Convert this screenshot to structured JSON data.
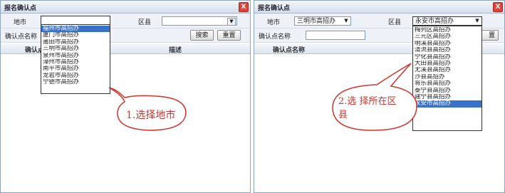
{
  "left": {
    "title": "报名确认点",
    "close": "X",
    "city_label": "地市",
    "city_value": "",
    "district_label": "区县",
    "district_value": "",
    "point_label": "确认点名称",
    "search_btn": "搜索",
    "reset_btn": "重置",
    "col_name": "确认点",
    "col_desc": "描述",
    "dropdown_items": [
      "福州市高招办",
      "厦门市高招办",
      "莆田市高招办",
      "三明市高招办",
      "泉州市高招办",
      "漳州市高招办",
      "南平市高招办",
      "龙岩市高招办",
      "宁德市高招办"
    ],
    "callout": "1.选择地市"
  },
  "right": {
    "title": "报名确认点",
    "close": "X",
    "city_label": "地市",
    "city_value": "三明市高招办",
    "district_label": "区县",
    "district_value": "永安市高招办",
    "point_label": "确认点名称",
    "reset_btn_partial": "置",
    "col_name": "确认点名称",
    "dropdown_items": [
      "梅列区高招办",
      "三元区高招办",
      "明溪县高招办",
      "清流县高招办",
      "宁化县高招办",
      "大田县高招办",
      "尤溪县高招办",
      "沙县高招办",
      "将乐县高招办",
      "泰宁县高招办",
      "建宁县高招办",
      "永安市高招办"
    ],
    "callout_line1": "2.选 择所在区",
    "callout_line2": "县"
  }
}
